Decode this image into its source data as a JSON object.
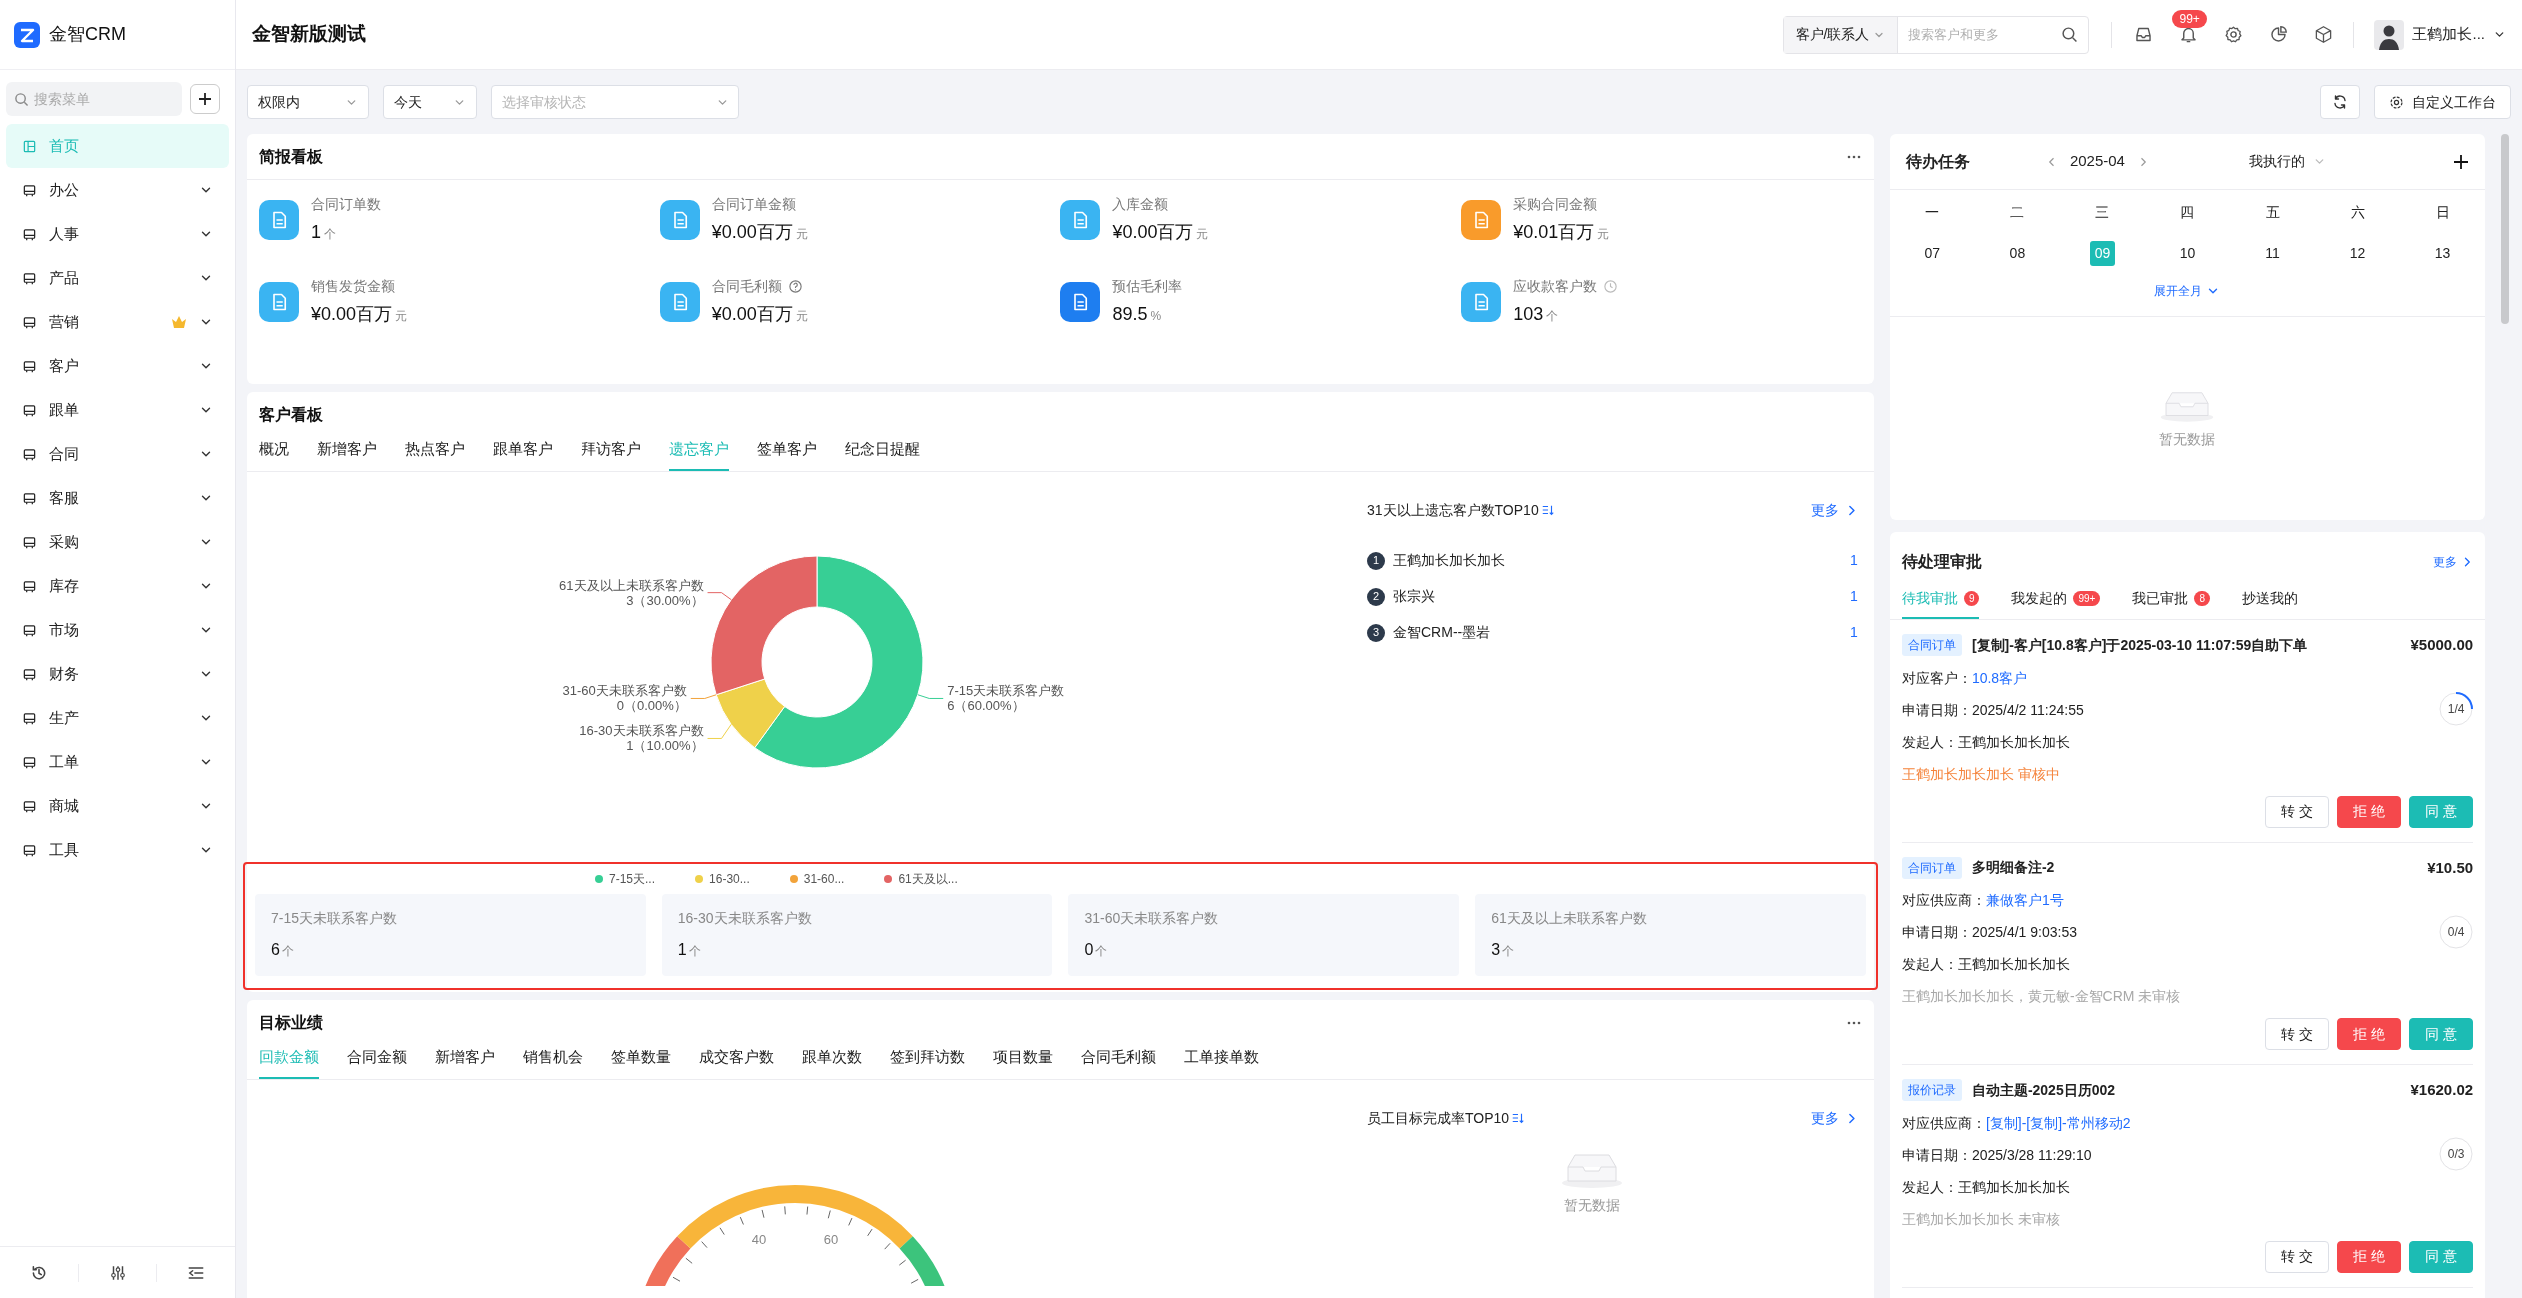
{
  "sidebar": {
    "logo": "金智CRM",
    "search_placeholder": "搜索菜单",
    "items": [
      {
        "label": "首页",
        "selected": true,
        "expandable": false,
        "crown": false
      },
      {
        "label": "办公",
        "selected": false,
        "expandable": true,
        "crown": false
      },
      {
        "label": "人事",
        "selected": false,
        "expandable": true,
        "crown": false
      },
      {
        "label": "产品",
        "selected": false,
        "expandable": true,
        "crown": false
      },
      {
        "label": "营销",
        "selected": false,
        "expandable": true,
        "crown": true
      },
      {
        "label": "客户",
        "selected": false,
        "expandable": true,
        "crown": false
      },
      {
        "label": "跟单",
        "selected": false,
        "expandable": true,
        "crown": false
      },
      {
        "label": "合同",
        "selected": false,
        "expandable": true,
        "crown": false
      },
      {
        "label": "客服",
        "selected": false,
        "expandable": true,
        "crown": false
      },
      {
        "label": "采购",
        "selected": false,
        "expandable": true,
        "crown": false
      },
      {
        "label": "库存",
        "selected": false,
        "expandable": true,
        "crown": false
      },
      {
        "label": "市场",
        "selected": false,
        "expandable": true,
        "crown": false
      },
      {
        "label": "财务",
        "selected": false,
        "expandable": true,
        "crown": false
      },
      {
        "label": "生产",
        "selected": false,
        "expandable": true,
        "crown": false
      },
      {
        "label": "工单",
        "selected": false,
        "expandable": true,
        "crown": false
      },
      {
        "label": "商城",
        "selected": false,
        "expandable": true,
        "crown": false
      },
      {
        "label": "工具",
        "selected": false,
        "expandable": true,
        "crown": false
      }
    ]
  },
  "header": {
    "title": "金智新版测试",
    "search_scope": "客户/联系人",
    "search_placeholder": "搜索客户和更多",
    "notification_badge": "99+",
    "user_name": "王鹤加长..."
  },
  "filters": {
    "scope": "权限内",
    "date": "今天",
    "status_placeholder": "选择审核状态",
    "customize_button": "自定义工作台"
  },
  "brief_board": {
    "title": "简报看板",
    "items": [
      {
        "label": "合同订单数",
        "value": "1",
        "unit": "个",
        "color": "#3ab4f2",
        "kind": "plain"
      },
      {
        "label": "合同订单金额",
        "value": "¥0.00百万",
        "unit": "元",
        "color": "#3ab4f2",
        "kind": "plain"
      },
      {
        "label": "入库金额",
        "value": "¥0.00百万",
        "unit": "元",
        "color": "#3ab4f2",
        "kind": "plain"
      },
      {
        "label": "采购合同金额",
        "value": "¥0.01百万",
        "unit": "元",
        "color": "#f99b2b",
        "kind": "plain"
      },
      {
        "label": "销售发货金额",
        "value": "¥0.00百万",
        "unit": "元",
        "color": "#3ab4f2",
        "kind": "plain"
      },
      {
        "label": "合同毛利额",
        "value": "¥0.00百万",
        "unit": "元",
        "color": "#3ab4f2",
        "kind": "help"
      },
      {
        "label": "预估毛利率",
        "value": "89.5",
        "unit": "%",
        "color": "#1e7ef0",
        "kind": "plain"
      },
      {
        "label": "应收款客户数",
        "value": "103",
        "unit": "个",
        "color": "#3ab4f2",
        "kind": "clock"
      }
    ]
  },
  "customer_board": {
    "title": "客户看板",
    "tabs": [
      {
        "label": "概况",
        "selected": false
      },
      {
        "label": "新增客户",
        "selected": false
      },
      {
        "label": "热点客户",
        "selected": false
      },
      {
        "label": "跟单客户",
        "selected": false
      },
      {
        "label": "拜访客户",
        "selected": false
      },
      {
        "label": "遗忘客户",
        "selected": true
      },
      {
        "label": "签单客户",
        "selected": false
      },
      {
        "label": "纪念日提醒",
        "selected": false
      }
    ],
    "chart_data": {
      "type": "donut",
      "categories": [
        "7-15天未联系客户数",
        "16-30天未联系客户数",
        "31-60天未联系客户数",
        "61天及以上未联系客户数"
      ],
      "values": [
        60,
        10,
        0,
        30
      ],
      "value_labels": [
        "6（60.00%）",
        "1（10.00%）",
        "0（0.00%）",
        "3（30.00%）"
      ]
    },
    "legend": [
      {
        "label": "7-15天...",
        "color": "#37cf95"
      },
      {
        "label": "16-30...",
        "color": "#efd14a"
      },
      {
        "label": "31-60...",
        "color": "#f2a33a"
      },
      {
        "label": "61天及以...",
        "color": "#e36464"
      }
    ],
    "stats_highlighted": true,
    "stats": [
      {
        "label": "7-15天未联系客户数",
        "value": "6",
        "unit": "个"
      },
      {
        "label": "16-30天未联系客户数",
        "value": "1",
        "unit": "个"
      },
      {
        "label": "31-60天未联系客户数",
        "value": "0",
        "unit": "个"
      },
      {
        "label": "61天及以上未联系客户数",
        "value": "3",
        "unit": "个"
      }
    ],
    "top10": {
      "title": "31天以上遗忘客户数TOP10",
      "more": "更多",
      "rows": [
        {
          "rank": "1",
          "name": "王鹤加长加长加长",
          "count": "1"
        },
        {
          "rank": "2",
          "name": "张宗兴",
          "count": "1"
        },
        {
          "rank": "3",
          "name": "金智CRM--墨岩",
          "count": "1"
        }
      ]
    }
  },
  "target_board": {
    "title": "目标业绩",
    "tabs": [
      {
        "label": "回款金额",
        "selected": true
      },
      {
        "label": "合同金额",
        "selected": false
      },
      {
        "label": "新增客户",
        "selected": false
      },
      {
        "label": "销售机会",
        "selected": false
      },
      {
        "label": "签单数量",
        "selected": false
      },
      {
        "label": "成交客户数",
        "selected": false
      },
      {
        "label": "跟单次数",
        "selected": false
      },
      {
        "label": "签到拜访数",
        "selected": false
      },
      {
        "label": "项目数量",
        "selected": false
      },
      {
        "label": "合同毛利额",
        "selected": false
      },
      {
        "label": "工单接单数",
        "selected": false
      }
    ],
    "gauge_ticks": [
      "40",
      "60"
    ],
    "top10": {
      "title": "员工目标完成率TOP10",
      "more": "更多",
      "empty": "暂无数据"
    }
  },
  "todo": {
    "title": "待办任务",
    "month": "2025-04",
    "filter": "我执行的",
    "weekdays": [
      "一",
      "二",
      "三",
      "四",
      "五",
      "六",
      "日"
    ],
    "days": [
      {
        "label": "07",
        "selected": false
      },
      {
        "label": "08",
        "selected": false
      },
      {
        "label": "09",
        "selected": true
      },
      {
        "label": "10",
        "selected": false
      },
      {
        "label": "11",
        "selected": false
      },
      {
        "label": "12",
        "selected": false
      },
      {
        "label": "13",
        "selected": false
      }
    ],
    "expand": "展开全月",
    "empty": "暂无数据"
  },
  "approvals": {
    "title": "待处理审批",
    "more": "更多",
    "tabs": [
      {
        "label": "待我审批",
        "badge": "9",
        "selected": true
      },
      {
        "label": "我发起的",
        "badge": "99+",
        "selected": false
      },
      {
        "label": "我已审批",
        "badge": "8",
        "selected": false
      },
      {
        "label": "抄送我的",
        "selected": false
      }
    ],
    "items": [
      {
        "tag": "合同订单",
        "title": "[复制]-客户[10.8客户]于2025-03-10 11:07:59自助下单",
        "amount": "¥5000.00",
        "fields": [
          {
            "label": "对应客户：",
            "value": "10.8客户",
            "link": true
          },
          {
            "label": "申请日期：",
            "value": "2025/4/2 11:24:55",
            "link": false
          },
          {
            "label": "发起人：",
            "value": "王鹤加长加长加长",
            "link": false
          }
        ],
        "status": {
          "text": "王鹤加长加长加长 审核中",
          "kind": "reviewing"
        },
        "progress": "1/4",
        "buttons": [
          {
            "label": "转 交",
            "kind": "default"
          },
          {
            "label": "拒 绝",
            "kind": "danger"
          },
          {
            "label": "同 意",
            "kind": "primary"
          }
        ]
      },
      {
        "tag": "合同订单",
        "title": "多明细备注-2",
        "amount": "¥10.50",
        "fields": [
          {
            "label": "对应供应商：",
            "value": "兼做客户1号",
            "link": true
          },
          {
            "label": "申请日期：",
            "value": "2025/4/1 9:03:53",
            "link": false
          },
          {
            "label": "发起人：",
            "value": "王鹤加长加长加长",
            "link": false
          }
        ],
        "status": {
          "text": "王鹤加长加长加长，黄元敏-金智CRM 未审核",
          "kind": "waiting"
        },
        "progress": "0/4",
        "buttons": [
          {
            "label": "转 交",
            "kind": "default"
          },
          {
            "label": "拒 绝",
            "kind": "danger"
          },
          {
            "label": "同 意",
            "kind": "primary"
          }
        ]
      },
      {
        "tag": "报价记录",
        "title": "自动主题-2025日历002",
        "amount": "¥1620.02",
        "fields": [
          {
            "label": "对应供应商：",
            "value": "[复制]-[复制]-常州移动2",
            "link": true
          },
          {
            "label": "申请日期：",
            "value": "2025/3/28 11:29:10",
            "link": false
          },
          {
            "label": "发起人：",
            "value": "王鹤加长加长加长",
            "link": false
          }
        ],
        "status": {
          "text": "王鹤加长加长加长 未审核",
          "kind": "waiting"
        },
        "progress": "0/3",
        "buttons": [
          {
            "label": "转 交",
            "kind": "default"
          },
          {
            "label": "拒 绝",
            "kind": "danger"
          },
          {
            "label": "同 意",
            "kind": "primary"
          }
        ]
      }
    ]
  }
}
